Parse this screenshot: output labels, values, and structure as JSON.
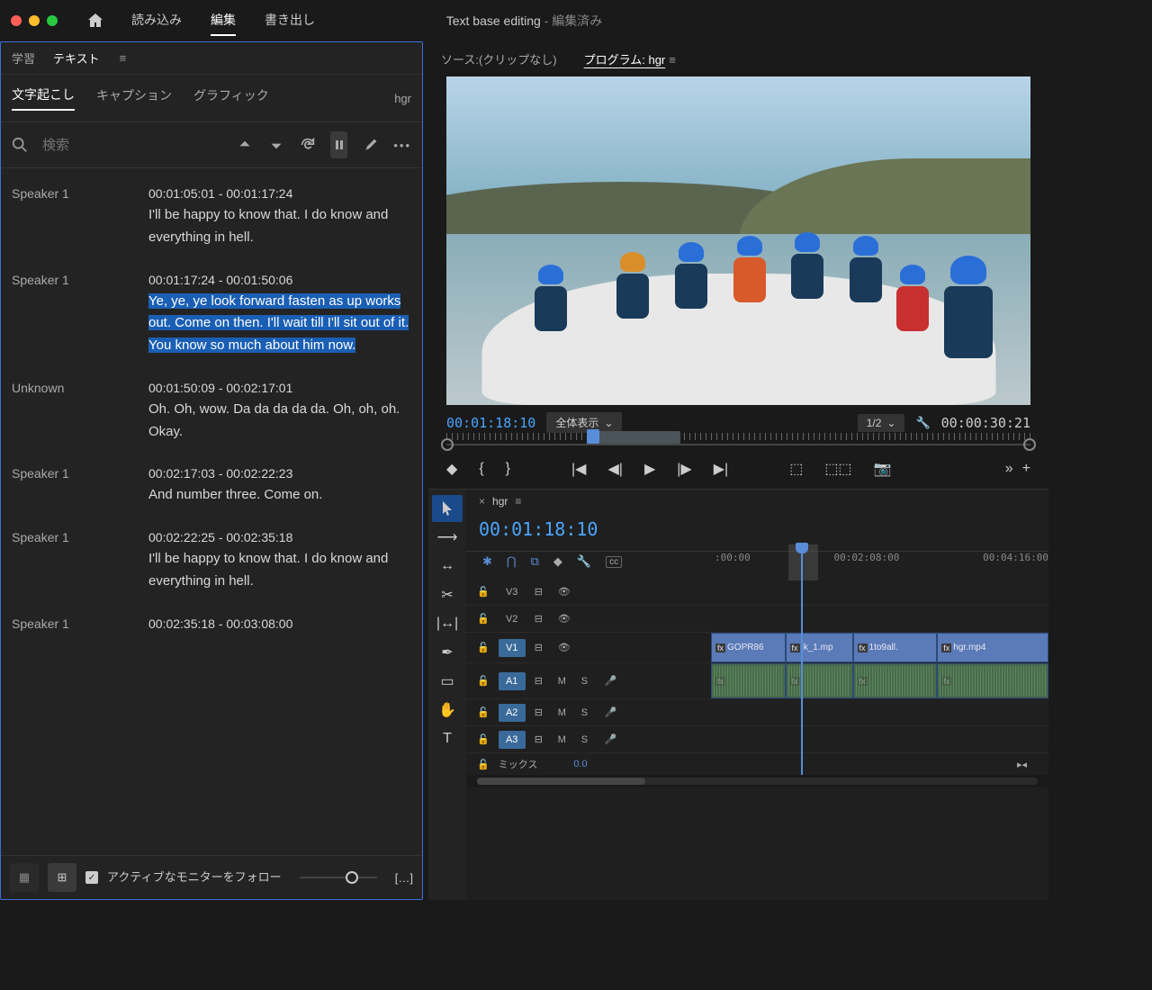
{
  "titlebar": {
    "tabs": {
      "import": "読み込み",
      "edit": "編集",
      "export": "書き出し"
    },
    "doc": "Text base editing",
    "doc_status": "- 編集済み"
  },
  "left": {
    "header": {
      "learn": "学習",
      "text": "テキスト"
    },
    "subtabs": {
      "transcribe": "文字起こし",
      "caption": "キャプション",
      "graphic": "グラフィック",
      "seq": "hgr"
    },
    "search_placeholder": "検索",
    "entries": [
      {
        "speaker": "Speaker 1",
        "tc": "00:01:05:01 - 00:01:17:24",
        "text": "I'll be happy to know that. I do know and everything in hell.",
        "hl": false
      },
      {
        "speaker": "Speaker 1",
        "tc": "00:01:17:24 - 00:01:50:06",
        "text": "Ye, ye, ye look forward fasten as up works out. Come on then. I'll wait till I'll sit out of it. You know so much about him now.",
        "hl": true
      },
      {
        "speaker": "Unknown",
        "tc": "00:01:50:09 - 00:02:17:01",
        "text": "Oh. Oh, wow. Da da da da da. Oh, oh, oh. Okay.",
        "hl": false
      },
      {
        "speaker": "Speaker 1",
        "tc": "00:02:17:03 - 00:02:22:23",
        "text": "And number three. Come on.",
        "hl": false
      },
      {
        "speaker": "Speaker 1",
        "tc": "00:02:22:25 - 00:02:35:18",
        "text": "I'll be happy to know that. I do know and everything in hell.",
        "hl": false
      },
      {
        "speaker": "Speaker 1",
        "tc": "00:02:35:18 - 00:03:08:00",
        "text": "",
        "hl": false
      }
    ],
    "footer": {
      "follow": "アクティブなモニターをフォロー",
      "more": "[…]"
    }
  },
  "monitor": {
    "source": "ソース:(クリップなし)",
    "program": "プログラム: hgr",
    "tc_left": "00:01:18:10",
    "zoom": "全体表示",
    "res": "1/2",
    "tc_right": "00:00:30:21"
  },
  "timeline": {
    "seqname": "hgr",
    "tc": "00:01:18:10",
    "ruler": [
      ":00:00",
      "00:02:08:00",
      "00:04:16:00"
    ],
    "tracks": {
      "v3": "V3",
      "v2": "V2",
      "v1": "V1",
      "a1": "A1",
      "a2": "A2",
      "a3": "A3",
      "m": "M",
      "s": "S",
      "mix": "ミックス",
      "mixval": "0.0"
    },
    "clips": {
      "c1": "GOPR86",
      "c2": "ik_1.mp",
      "c3": "1to9all.",
      "c4": "hgr.mp4"
    }
  }
}
